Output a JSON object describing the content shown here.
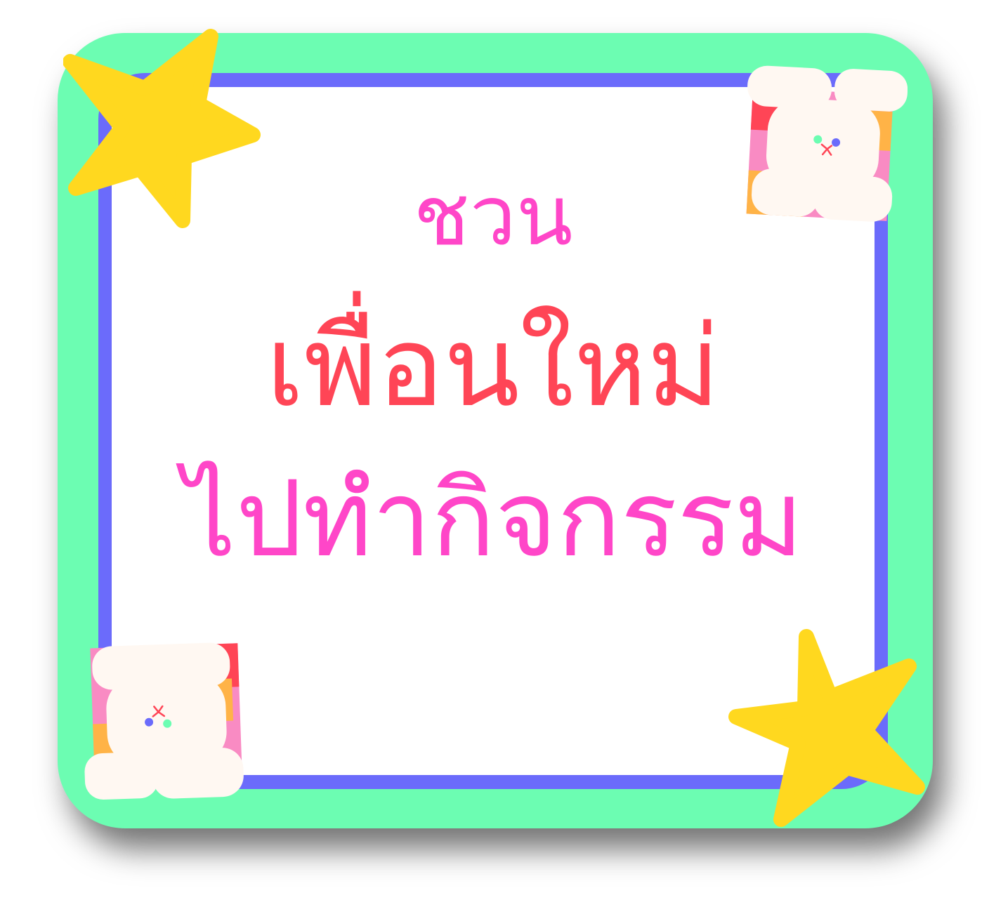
{
  "headline": {
    "line1": "ชวน",
    "line2": "เพื่อนใหม่",
    "line3": "ไปทำกิจกรรม"
  },
  "colors": {
    "frame_outer": "#6cfdb2",
    "frame_border": "#6b6bfb",
    "panel": "#ffffff",
    "text_pink": "#ff46c8",
    "text_red": "#ff4556",
    "star": "#ffd81f",
    "bear_body": "#fff8f2",
    "tile_pink": "#f98bc3",
    "tile_orange": "#ffb347"
  },
  "icons": [
    "star-icon",
    "bear-sticker-icon"
  ]
}
